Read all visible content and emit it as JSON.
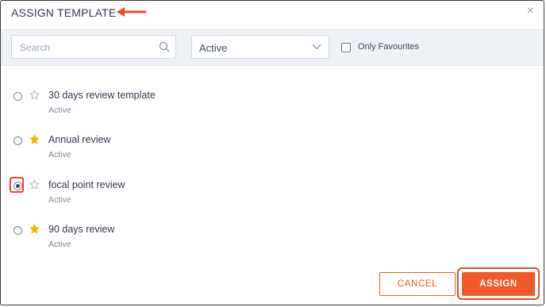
{
  "dialog": {
    "title": "ASSIGN TEMPLATE",
    "close_symbol": "×"
  },
  "filters": {
    "search_placeholder": "Search",
    "search_value": "",
    "status_selected": "Active",
    "only_favourites_label": "Only Favourites",
    "only_favourites_checked": false
  },
  "templates": [
    {
      "name": "30 days review template",
      "status": "Active",
      "favourite": false,
      "selected": false
    },
    {
      "name": "Annual review",
      "status": "Active",
      "favourite": true,
      "selected": false
    },
    {
      "name": "focal point review",
      "status": "Active",
      "favourite": false,
      "selected": true
    },
    {
      "name": "90 days review",
      "status": "Active",
      "favourite": true,
      "selected": false
    }
  ],
  "actions": {
    "cancel_label": "CANCEL",
    "assign_label": "ASSIGN"
  },
  "colors": {
    "accent": "#f05a28",
    "highlight": "#e24d2b",
    "star_filled": "#f4b400",
    "star_outline": "#a8b0bc",
    "filter_bar_bg": "#eef1f6"
  },
  "icons": {
    "search": "search-icon",
    "chevron": "chevron-down-icon",
    "close": "close-icon",
    "star": "star-icon",
    "arrow": "arrow-left-icon"
  }
}
